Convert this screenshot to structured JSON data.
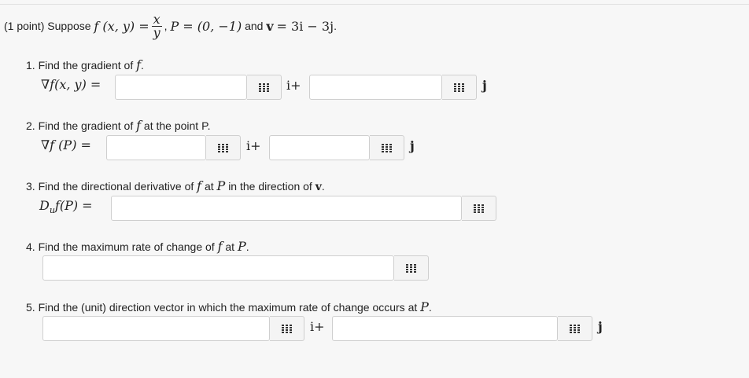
{
  "problem": {
    "points": "(1 point)",
    "suppose": "Suppose",
    "f_lhs": "f (x, y) =",
    "frac_num": "x",
    "frac_den": "y",
    "sep": ",",
    "P_def": "P = (0, −1)",
    "and_word": "and",
    "v_sym": "v",
    "v_rhs": "= 3i − 3j",
    "period": "."
  },
  "q1": {
    "number": "1.",
    "text": "Find the gradient of",
    "f_sym": "f",
    "period": ".",
    "math_label": "∇f(x, y) =",
    "i_suffix": "i+",
    "j_suffix": "j",
    "input_i_value": "",
    "input_j_value": ""
  },
  "q2": {
    "number": "2.",
    "text": "Find the gradient of",
    "f_sym": "f",
    "text_after": "at the point P.",
    "math_label": "∇f (P) =",
    "i_suffix": "i+",
    "j_suffix": "j",
    "input_i_value": "",
    "input_j_value": ""
  },
  "q3": {
    "number": "3.",
    "text": "Find the directional derivative of",
    "f_sym": "f",
    "at_word": "at",
    "P_sym": "P",
    "text_after": "in the direction of",
    "v_sym": "v",
    "period": ".",
    "math_label": "D",
    "math_sub": "u",
    "math_label_rest": "f(P) =",
    "input_value": ""
  },
  "q4": {
    "number": "4.",
    "text": "Find the maximum rate of change of",
    "f_sym": "f",
    "at_word": "at",
    "P_sym": "P",
    "period": ".",
    "input_value": ""
  },
  "q5": {
    "number": "5.",
    "text": "Find the (unit) direction vector in which the maximum rate of change occurs at",
    "P_sym": "P",
    "period": ".",
    "i_suffix": "i+",
    "j_suffix": "j",
    "input_i_value": "",
    "input_j_value": ""
  },
  "icons": {
    "equation_editor": "grid-icon"
  }
}
